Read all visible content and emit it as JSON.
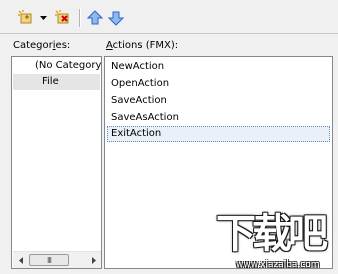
{
  "toolbar": {
    "items": [
      {
        "icon": "new-action-icon"
      },
      {
        "icon": "dropdown-arrow-icon"
      },
      {
        "icon": "delete-action-icon"
      },
      {
        "icon": "move-up-icon"
      },
      {
        "icon": "move-down-icon"
      }
    ]
  },
  "categories": {
    "label_prefix": "Categor",
    "label_mnemonic": "i",
    "label_suffix": "es:",
    "items": [
      "(No Category)",
      "File"
    ],
    "selected": "File"
  },
  "actions": {
    "label_mnemonic": "A",
    "label_suffix": "ctions (FMX):",
    "items": [
      "NewAction",
      "OpenAction",
      "SaveAction",
      "SaveAsAction",
      "ExitAction"
    ],
    "focused": "ExitAction"
  },
  "scrollbar": {
    "thumb_grip": "III"
  },
  "watermark": {
    "logo_text": "下载吧",
    "url": "www.xiazaiba.com"
  },
  "colors": {
    "accent_blue": "#4a7fd1",
    "focus_border": "#6c8ab9"
  }
}
